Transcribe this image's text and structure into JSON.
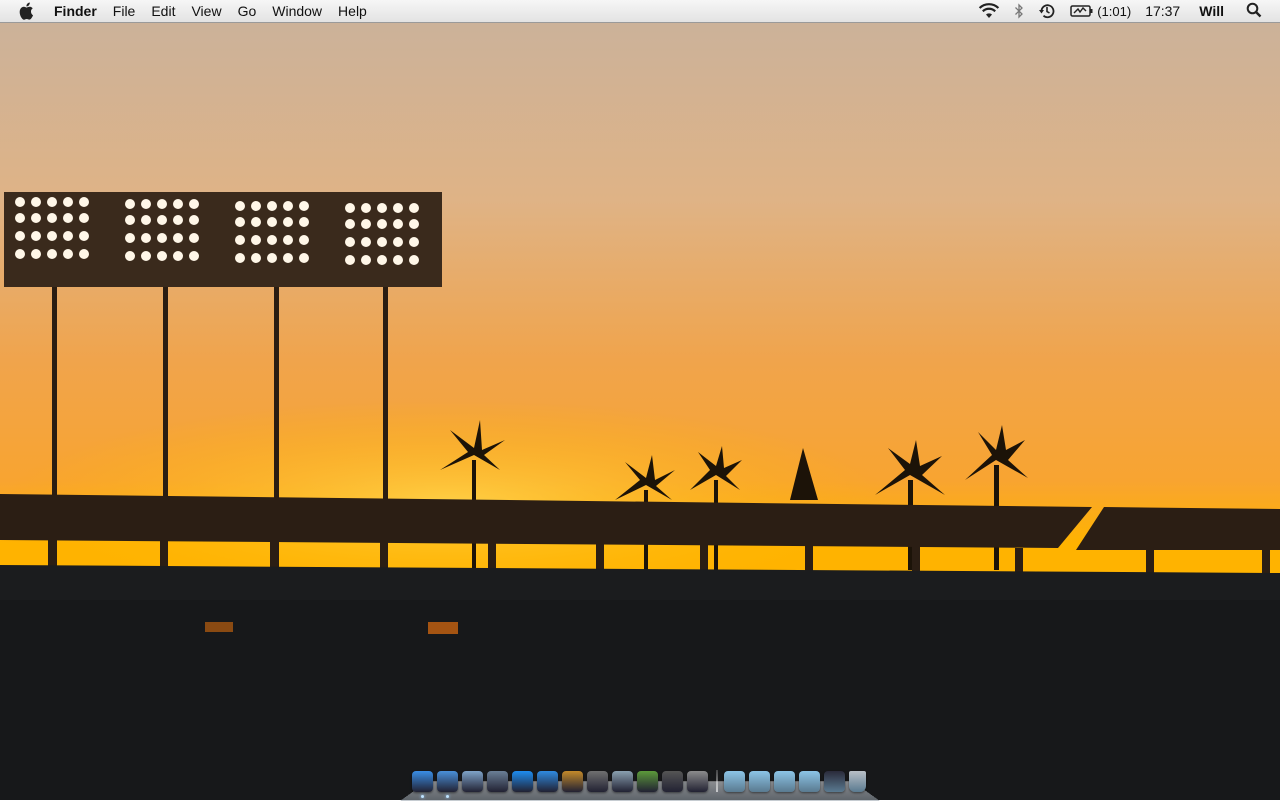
{
  "menubar": {
    "apple_icon": "apple-logo-icon",
    "app_name": "Finder",
    "menus": [
      "File",
      "Edit",
      "View",
      "Go",
      "Window",
      "Help"
    ],
    "status": {
      "wifi_icon": "wifi-icon",
      "bluetooth_icon": "bluetooth-icon",
      "time_machine_icon": "time-machine-icon",
      "battery_icon": "battery-charging-icon",
      "battery_text": "(1:01)",
      "clock": "17:37",
      "user": "Will",
      "spotlight_icon": "spotlight-search-icon"
    }
  },
  "desktop": {
    "wallpaper": "stadium-sunset-silhouette",
    "colors": {
      "sky_top": "#d2b9a0",
      "sky_mid": "#f0a545",
      "horizon": "#ffb400",
      "stands": "#1a1c1e"
    }
  },
  "dock": {
    "apps": [
      {
        "name": "finder-icon",
        "color": "#3a8ee6",
        "running": true
      },
      {
        "name": "safari-icon",
        "color": "#4a90d9",
        "running": true
      },
      {
        "name": "mail-icon",
        "color": "#7fa3c8",
        "running": false
      },
      {
        "name": "xcode-icon",
        "color": "#6a7f96",
        "running": false
      },
      {
        "name": "app-store-icon",
        "color": "#1e8df0",
        "running": false
      },
      {
        "name": "itunes-icon",
        "color": "#2f8be0",
        "running": false
      },
      {
        "name": "iphoto-icon",
        "color": "#c48a2a",
        "running": false
      },
      {
        "name": "imovie-icon",
        "color": "#707070",
        "running": false
      },
      {
        "name": "utility-icon",
        "color": "#8aa0b0",
        "running": false
      },
      {
        "name": "minecraft-icon",
        "color": "#5c9a3a",
        "running": false
      },
      {
        "name": "terminal-icon",
        "color": "#555555",
        "running": false
      },
      {
        "name": "system-preferences-icon",
        "color": "#8c8c8c",
        "running": false
      }
    ],
    "stacks": [
      {
        "name": "downloads-folder-icon",
        "color": "#8cc4e6"
      },
      {
        "name": "applications-folder-icon",
        "color": "#8cc4e6"
      },
      {
        "name": "documents-folder-icon",
        "color": "#8cc4e6"
      },
      {
        "name": "folder-icon",
        "color": "#8cc4e6"
      },
      {
        "name": "screen-capture-stack-icon",
        "color": "#2a2a3a"
      },
      {
        "name": "trash-icon",
        "color": "#b9bfc6"
      }
    ]
  }
}
